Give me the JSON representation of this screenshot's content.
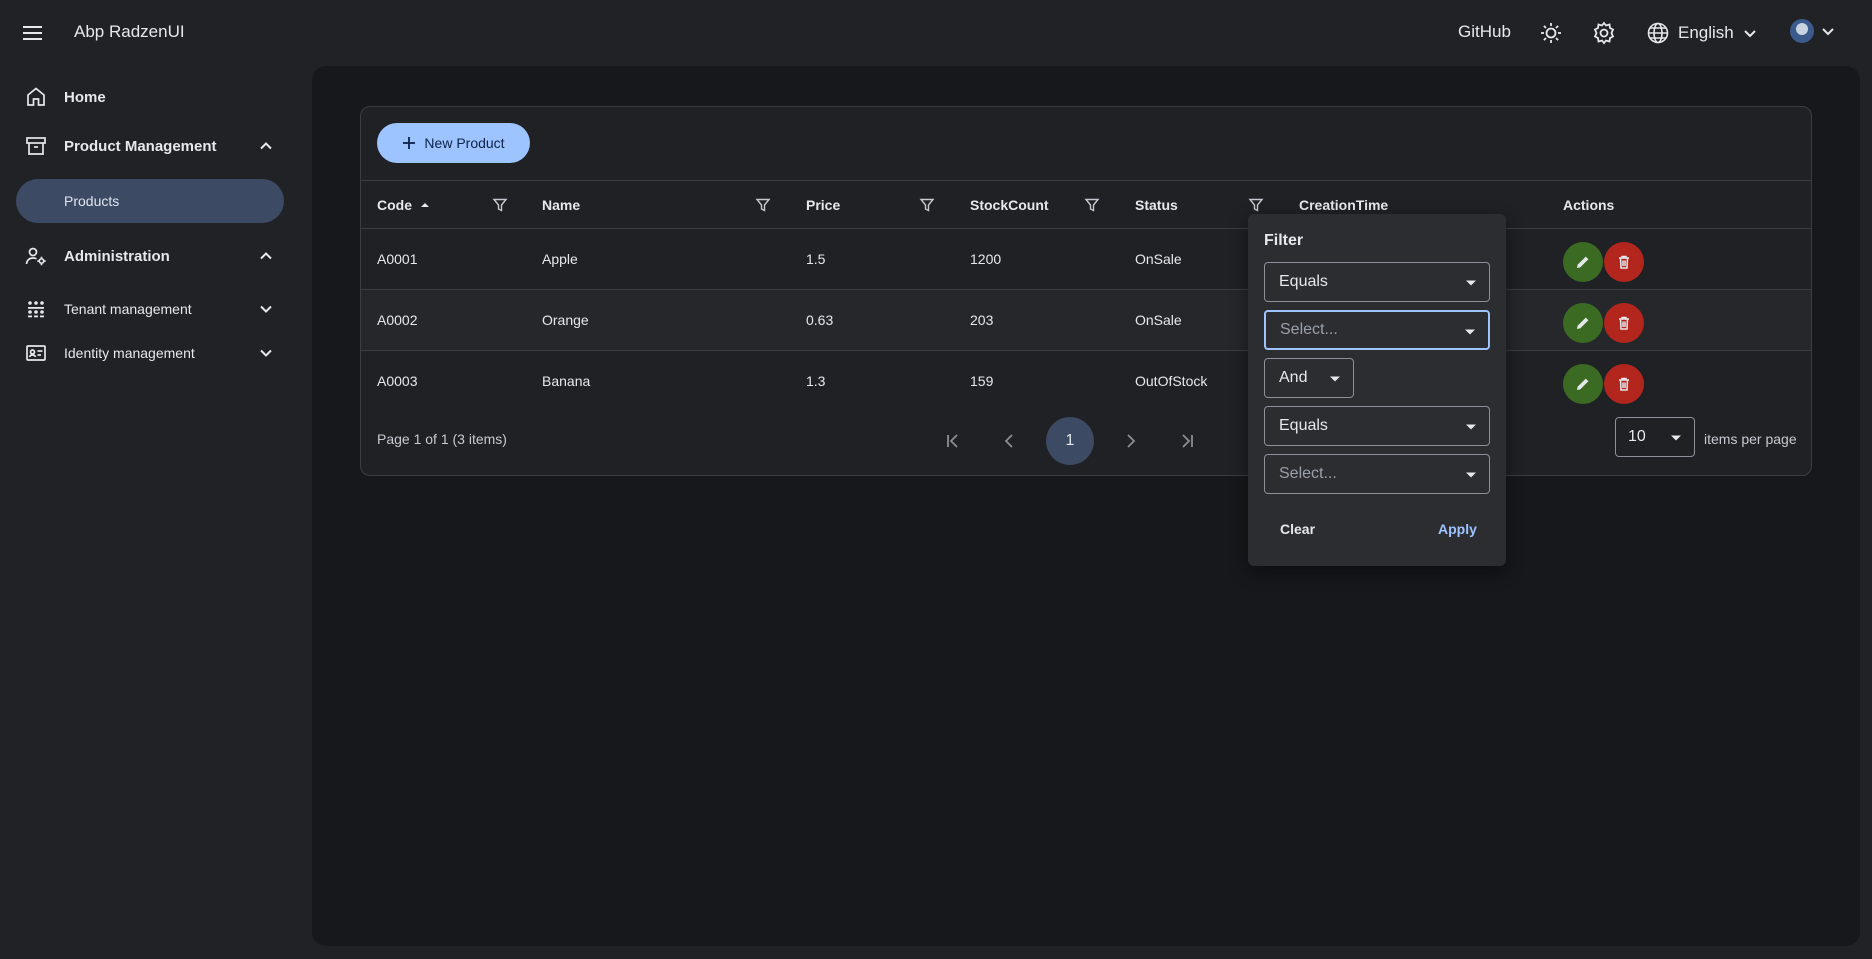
{
  "header": {
    "title": "Abp RadzenUI",
    "github_label": "GitHub",
    "language_label": "English",
    "icons": [
      "menu-icon",
      "sun-icon",
      "gear-icon",
      "globe-icon",
      "chevron-down-icon",
      "avatar"
    ]
  },
  "sidebar": {
    "items": [
      {
        "label": "Home",
        "icon": "home-icon"
      },
      {
        "label": "Product Management",
        "icon": "archive-icon"
      },
      {
        "label": "Products"
      },
      {
        "label": "Administration",
        "icon": "user-gear-icon"
      },
      {
        "label": "Tenant management",
        "icon": "network-icon"
      },
      {
        "label": "Identity management",
        "icon": "id-card-icon"
      }
    ]
  },
  "toolbar": {
    "new_label": "New Product"
  },
  "grid": {
    "columns": [
      "Code",
      "Name",
      "Price",
      "StockCount",
      "Status",
      "CreationTime",
      "Actions"
    ],
    "rows": [
      {
        "code": "A0001",
        "name": "Apple",
        "price": "1.5",
        "stock": "1200",
        "status": "OnSale"
      },
      {
        "code": "A0002",
        "name": "Orange",
        "price": "0.63",
        "stock": "203",
        "status": "OnSale"
      },
      {
        "code": "A0003",
        "name": "Banana",
        "price": "1.3",
        "stock": "159",
        "status": "OutOfStock"
      }
    ]
  },
  "pager": {
    "summary": "Page 1 of 1 (3 items)",
    "current_page": "1",
    "page_size": "10",
    "page_size_label": "items per page"
  },
  "filter": {
    "title": "Filter",
    "operator1": "Equals",
    "value1_placeholder": "Select...",
    "logic": "And",
    "operator2": "Equals",
    "value2_placeholder": "Select...",
    "clear_label": "Clear",
    "apply_label": "Apply"
  },
  "colors": {
    "accent": "#9ec4ff",
    "edit": "#3b6b22",
    "delete": "#b3261e",
    "selected_nav": "#3d4a63"
  }
}
